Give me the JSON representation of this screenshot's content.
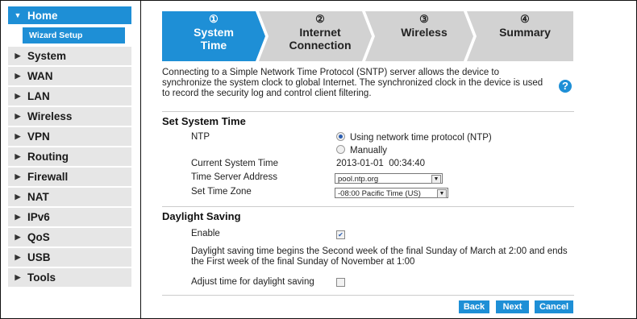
{
  "sidebar": {
    "items": [
      {
        "label": "Home",
        "active": true
      },
      {
        "label": "System"
      },
      {
        "label": "WAN"
      },
      {
        "label": "LAN"
      },
      {
        "label": "Wireless"
      },
      {
        "label": "VPN"
      },
      {
        "label": "Routing"
      },
      {
        "label": "Firewall"
      },
      {
        "label": "NAT"
      },
      {
        "label": "IPv6"
      },
      {
        "label": "QoS"
      },
      {
        "label": "USB"
      },
      {
        "label": "Tools"
      }
    ],
    "subitem": "Wizard Setup"
  },
  "wizard": {
    "steps": [
      {
        "num": "①",
        "line1": "System",
        "line2": "Time",
        "active": true
      },
      {
        "num": "②",
        "line1": "Internet",
        "line2": "Connection"
      },
      {
        "num": "③",
        "line1": "Wireless",
        "line2": ""
      },
      {
        "num": "④",
        "line1": "Summary",
        "line2": ""
      }
    ],
    "active_color": "#1e8fd6",
    "inactive_color": "#d2d2d2"
  },
  "description": "Connecting to a Simple Network Time Protocol (SNTP) server allows the device to synchronize the system clock to global Internet. The synchronized clock in the device is used to record the security log and control client filtering.",
  "help_icon": "?",
  "set_time": {
    "title": "Set System Time",
    "ntp_label": "NTP",
    "ntp_option": "Using network time protocol (NTP)",
    "manual_option": "Manually",
    "current_time_label": "Current System Time",
    "current_time_value": "2013-01-01  00:34:40",
    "server_label": "Time Server Address",
    "server_value": "pool.ntp.org",
    "zone_label": "Set Time Zone",
    "zone_value": "-08:00 Pacific Time (US)"
  },
  "daylight": {
    "title": "Daylight Saving",
    "enable_label": "Enable",
    "enable_checked": true,
    "note": "Daylight saving time begins the Second week of the final Sunday of March at 2:00 and ends the First week of the final Sunday of November at 1:00",
    "adjust_label": "Adjust time for daylight saving",
    "adjust_checked": false
  },
  "buttons": {
    "back": "Back",
    "next": "Next",
    "cancel": "Cancel"
  }
}
